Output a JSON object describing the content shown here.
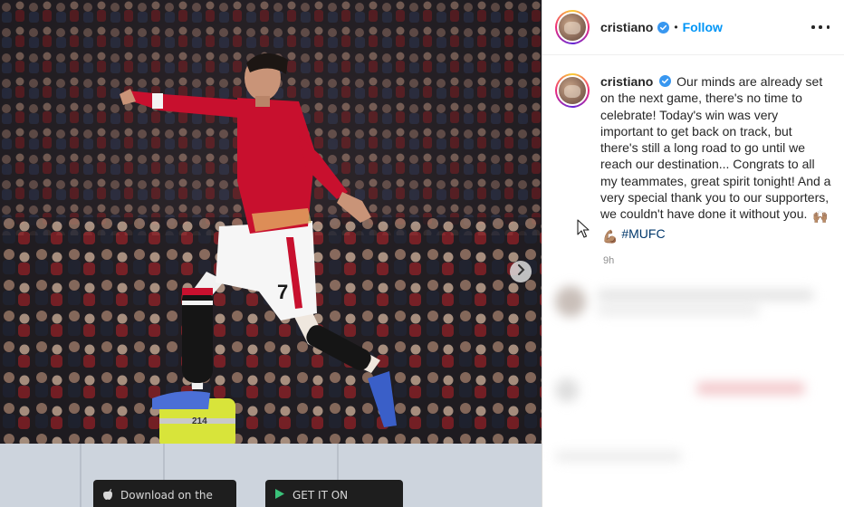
{
  "post": {
    "username": "cristiano",
    "verified": true,
    "follow_label": "Follow",
    "separator": "•",
    "more_icon": "more-options-icon",
    "caption": {
      "username": "cristiano",
      "text": "Our minds are already set on the next game, there's no time to celebrate! Today's win was very important to get back on track, but there's still a long road to go until we reach our destination... Congrats to all my teammates, great spirit tonight! And a very special thank you to our supporters, we couldn't have done it without you.",
      "emojis": [
        "🙌🏽",
        "💪🏽"
      ],
      "hashtag": "#MUFC"
    },
    "timestamp": "9h"
  },
  "media": {
    "jersey_number": "7",
    "steward_number": "214",
    "app_store_label": "Download on the",
    "play_store_label": "GET IT ON",
    "next_icon": "chevron-right-icon"
  },
  "colors": {
    "follow": "#0095f6",
    "verified": "#3897f0",
    "hashtag": "#00376b",
    "jersey_red": "#c8102e"
  }
}
